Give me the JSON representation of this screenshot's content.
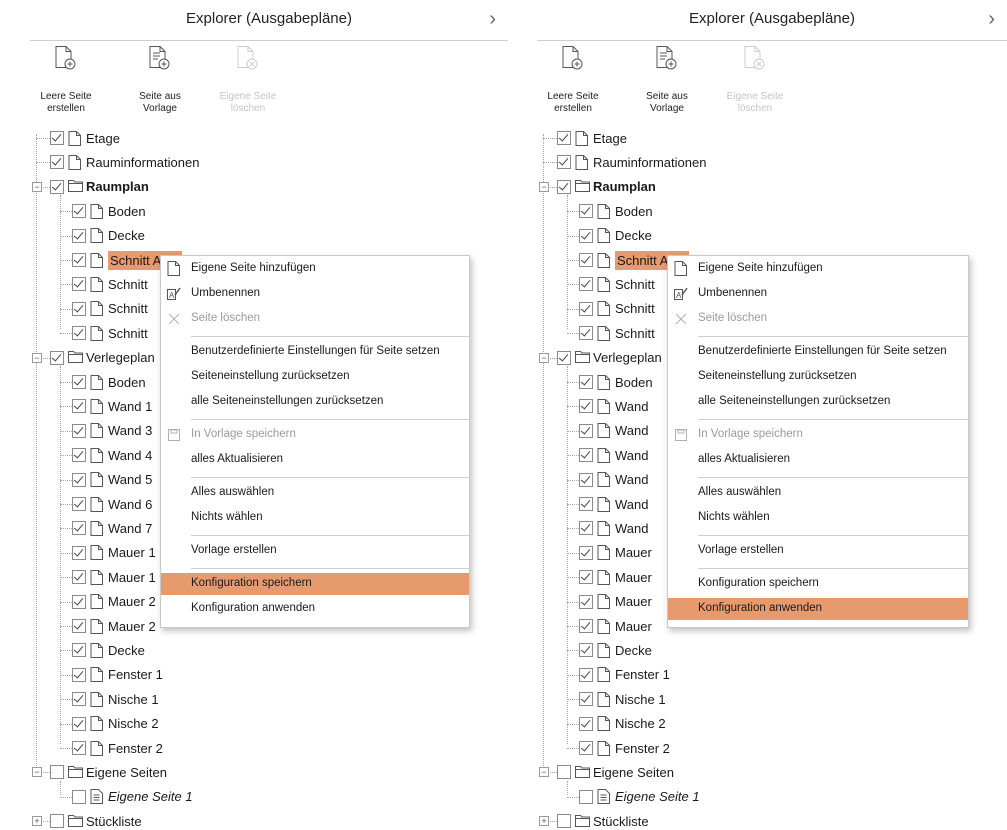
{
  "panel_left": {
    "title": "Explorer (Ausgabepläne)",
    "toolbar": [
      {
        "label_line1": "Leere Seite",
        "label_line2": "erstellen",
        "enabled": true,
        "icon": "new-page-icon"
      },
      {
        "label_line1": "Seite aus",
        "label_line2": "Vorlage",
        "enabled": true,
        "icon": "page-from-template-icon"
      },
      {
        "label_line1": "Eigene Seite",
        "label_line2": "löschen",
        "enabled": false,
        "icon": "delete-page-icon"
      }
    ],
    "tree": [
      {
        "label": "Etage",
        "checked": true,
        "type": "page",
        "level": 1
      },
      {
        "label": "Rauminformationen",
        "checked": true,
        "type": "page",
        "level": 1
      },
      {
        "label": "Raumplan",
        "checked": true,
        "type": "folder",
        "level": 1,
        "bold": true
      },
      {
        "label": "Boden",
        "checked": true,
        "type": "page",
        "level": 2
      },
      {
        "label": "Decke",
        "checked": true,
        "type": "page",
        "level": 2
      },
      {
        "label": "Schnitt A - A",
        "checked": true,
        "type": "page",
        "level": 2,
        "selected": true
      },
      {
        "label": "Schnitt",
        "checked": true,
        "type": "page",
        "level": 2
      },
      {
        "label": "Schnitt",
        "checked": true,
        "type": "page",
        "level": 2
      },
      {
        "label": "Schnitt",
        "checked": true,
        "type": "page",
        "level": 2
      },
      {
        "label": "Verlegeplan",
        "checked": true,
        "type": "folder",
        "level": 1
      },
      {
        "label": "Boden",
        "checked": true,
        "type": "page",
        "level": 2
      },
      {
        "label": "Wand 1",
        "checked": true,
        "type": "page",
        "level": 2
      },
      {
        "label": "Wand 3",
        "checked": true,
        "type": "page",
        "level": 2
      },
      {
        "label": "Wand 4",
        "checked": true,
        "type": "page",
        "level": 2
      },
      {
        "label": "Wand 5",
        "checked": true,
        "type": "page",
        "level": 2
      },
      {
        "label": "Wand 6",
        "checked": true,
        "type": "page",
        "level": 2
      },
      {
        "label": "Wand 7",
        "checked": true,
        "type": "page",
        "level": 2
      },
      {
        "label": "Mauer 1",
        "checked": true,
        "type": "page",
        "level": 2
      },
      {
        "label": "Mauer 1",
        "checked": true,
        "type": "page",
        "level": 2
      },
      {
        "label": "Mauer 2",
        "checked": true,
        "type": "page",
        "level": 2
      },
      {
        "label": "Mauer 2",
        "checked": true,
        "type": "page",
        "level": 2
      },
      {
        "label": "Decke",
        "checked": true,
        "type": "page",
        "level": 2
      },
      {
        "label": "Fenster 1",
        "checked": true,
        "type": "page",
        "level": 2
      },
      {
        "label": "Nische 1",
        "checked": true,
        "type": "page",
        "level": 2
      },
      {
        "label": "Nische 2",
        "checked": true,
        "type": "page",
        "level": 2
      },
      {
        "label": "Fenster 2",
        "checked": true,
        "type": "page",
        "level": 2
      },
      {
        "label": "Eigene Seiten",
        "checked": false,
        "type": "folder",
        "level": 1
      },
      {
        "label": "Eigene Seite 1",
        "checked": false,
        "type": "custom",
        "level": 2,
        "italic": true
      },
      {
        "label": "Stückliste",
        "checked": false,
        "type": "folder",
        "level": 1,
        "collapsed": true
      }
    ],
    "context_menu": {
      "highlighted": "Konfiguration speichern",
      "items": [
        {
          "label": "Eigene Seite hinzufügen",
          "icon": "add-page-icon",
          "enabled": true
        },
        {
          "label": "Umbenennen",
          "icon": "rename-icon",
          "enabled": true
        },
        {
          "label": "Seite löschen",
          "icon": "delete-x-icon",
          "enabled": false
        },
        {
          "separator": true
        },
        {
          "label": "Benutzerdefinierte Einstellungen für Seite setzen",
          "enabled": true
        },
        {
          "label": "Seiteneinstellung zurücksetzen",
          "enabled": true
        },
        {
          "label": "alle Seiteneinstellungen zurücksetzen",
          "enabled": true
        },
        {
          "separator": true
        },
        {
          "label": "In Vorlage speichern",
          "icon": "save-template-icon",
          "enabled": false
        },
        {
          "label": "alles Aktualisieren",
          "enabled": true
        },
        {
          "separator": true
        },
        {
          "label": "Alles auswählen",
          "enabled": true
        },
        {
          "label": "Nichts wählen",
          "enabled": true
        },
        {
          "separator": true
        },
        {
          "label": "Vorlage erstellen",
          "enabled": true
        },
        {
          "separator": true
        },
        {
          "label": "Konfiguration speichern",
          "enabled": true,
          "highlighted": true
        },
        {
          "label": "Konfiguration anwenden",
          "enabled": true
        }
      ]
    }
  },
  "panel_right": {
    "title": "Explorer (Ausgabepläne)",
    "toolbar": [
      {
        "label_line1": "Leere Seite",
        "label_line2": "erstellen",
        "enabled": true,
        "icon": "new-page-icon"
      },
      {
        "label_line1": "Seite aus",
        "label_line2": "Vorlage",
        "enabled": true,
        "icon": "page-from-template-icon"
      },
      {
        "label_line1": "Eigene Seite",
        "label_line2": "löschen",
        "enabled": false,
        "icon": "delete-page-icon"
      }
    ],
    "tree": [
      {
        "label": "Etage",
        "checked": true,
        "type": "page",
        "level": 1
      },
      {
        "label": "Rauminformationen",
        "checked": true,
        "type": "page",
        "level": 1
      },
      {
        "label": "Raumplan",
        "checked": true,
        "type": "folder",
        "level": 1,
        "bold": true
      },
      {
        "label": "Boden",
        "checked": true,
        "type": "page",
        "level": 2
      },
      {
        "label": "Decke",
        "checked": true,
        "type": "page",
        "level": 2
      },
      {
        "label": "Schnitt A - A",
        "checked": true,
        "type": "page",
        "level": 2,
        "selected": true
      },
      {
        "label": "Schnitt",
        "checked": true,
        "type": "page",
        "level": 2
      },
      {
        "label": "Schnitt",
        "checked": true,
        "type": "page",
        "level": 2
      },
      {
        "label": "Schnitt",
        "checked": true,
        "type": "page",
        "level": 2
      },
      {
        "label": "Verlegeplan",
        "checked": true,
        "type": "folder",
        "level": 1
      },
      {
        "label": "Boden",
        "checked": true,
        "type": "page",
        "level": 2
      },
      {
        "label": "Wand",
        "checked": true,
        "type": "page",
        "level": 2
      },
      {
        "label": "Wand",
        "checked": true,
        "type": "page",
        "level": 2
      },
      {
        "label": "Wand",
        "checked": true,
        "type": "page",
        "level": 2
      },
      {
        "label": "Wand",
        "checked": true,
        "type": "page",
        "level": 2
      },
      {
        "label": "Wand",
        "checked": true,
        "type": "page",
        "level": 2
      },
      {
        "label": "Wand",
        "checked": true,
        "type": "page",
        "level": 2
      },
      {
        "label": "Mauer",
        "checked": true,
        "type": "page",
        "level": 2
      },
      {
        "label": "Mauer",
        "checked": true,
        "type": "page",
        "level": 2
      },
      {
        "label": "Mauer",
        "checked": true,
        "type": "page",
        "level": 2
      },
      {
        "label": "Mauer",
        "checked": true,
        "type": "page",
        "level": 2
      },
      {
        "label": "Decke",
        "checked": true,
        "type": "page",
        "level": 2
      },
      {
        "label": "Fenster 1",
        "checked": true,
        "type": "page",
        "level": 2
      },
      {
        "label": "Nische 1",
        "checked": true,
        "type": "page",
        "level": 2
      },
      {
        "label": "Nische 2",
        "checked": true,
        "type": "page",
        "level": 2
      },
      {
        "label": "Fenster 2",
        "checked": true,
        "type": "page",
        "level": 2
      },
      {
        "label": "Eigene Seiten",
        "checked": false,
        "type": "folder",
        "level": 1
      },
      {
        "label": "Eigene Seite 1",
        "checked": false,
        "type": "custom",
        "level": 2,
        "italic": true
      },
      {
        "label": "Stückliste",
        "checked": false,
        "type": "folder",
        "level": 1,
        "collapsed": true
      }
    ],
    "context_menu": {
      "highlighted": "Konfiguration anwenden",
      "items": [
        {
          "label": "Eigene Seite hinzufügen",
          "icon": "add-page-icon",
          "enabled": true
        },
        {
          "label": "Umbenennen",
          "icon": "rename-icon",
          "enabled": true
        },
        {
          "label": "Seite löschen",
          "icon": "delete-x-icon",
          "enabled": false
        },
        {
          "separator": true
        },
        {
          "label": "Benutzerdefinierte Einstellungen für Seite setzen",
          "enabled": true
        },
        {
          "label": "Seiteneinstellung zurücksetzen",
          "enabled": true
        },
        {
          "label": "alle Seiteneinstellungen zurücksetzen",
          "enabled": true
        },
        {
          "separator": true
        },
        {
          "label": "In Vorlage speichern",
          "icon": "save-template-icon",
          "enabled": false
        },
        {
          "label": "alles Aktualisieren",
          "enabled": true
        },
        {
          "separator": true
        },
        {
          "label": "Alles auswählen",
          "enabled": true
        },
        {
          "label": "Nichts wählen",
          "enabled": true
        },
        {
          "separator": true
        },
        {
          "label": "Vorlage erstellen",
          "enabled": true
        },
        {
          "separator": true
        },
        {
          "label": "Konfiguration speichern",
          "enabled": true
        },
        {
          "label": "Konfiguration anwenden",
          "enabled": true,
          "highlighted": true
        }
      ]
    }
  },
  "colors": {
    "highlight": "#e89a6f",
    "border": "#cfcfcf",
    "disabled_text": "#9a9a9a"
  }
}
